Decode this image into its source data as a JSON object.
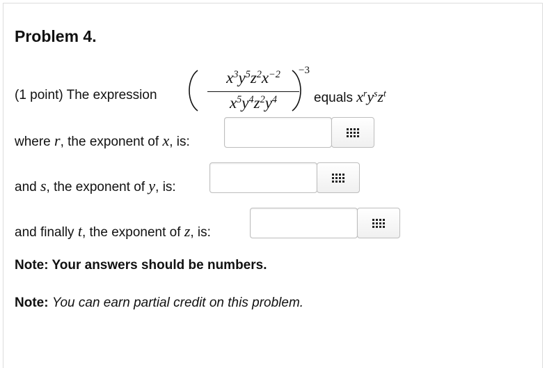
{
  "problem": {
    "title": "Problem 4.",
    "intro_prefix": "(1 point) The expression",
    "equals_text": "equals",
    "expression": {
      "numerator": [
        "x",
        "3",
        "y",
        "5",
        "z",
        "2",
        "x",
        "−2"
      ],
      "denominator": [
        "x",
        "5",
        "y",
        "4",
        "z",
        "2",
        "y",
        "4"
      ],
      "outer_exponent": "−3"
    },
    "result": {
      "x": "x",
      "r": "r",
      "y": "y",
      "s": "s",
      "z": "z",
      "t": "t"
    }
  },
  "answers": [
    {
      "pre": "where",
      "var": "r",
      "mid": ", the exponent of",
      "of": "x",
      "post": ", is:",
      "value": ""
    },
    {
      "pre": "and",
      "var": "s",
      "mid": ", the exponent of",
      "of": "y",
      "post": ", is:",
      "value": ""
    },
    {
      "pre": "and finally",
      "var": "t",
      "mid": ", the exponent of",
      "of": "z",
      "post": ", is:",
      "value": ""
    }
  ],
  "notes": {
    "note1": "Note: Your answers should be numbers.",
    "note2_label": "Note:",
    "note2_text": "You can earn partial credit on this problem."
  },
  "icons": {
    "equation_button": "grid-icon"
  }
}
